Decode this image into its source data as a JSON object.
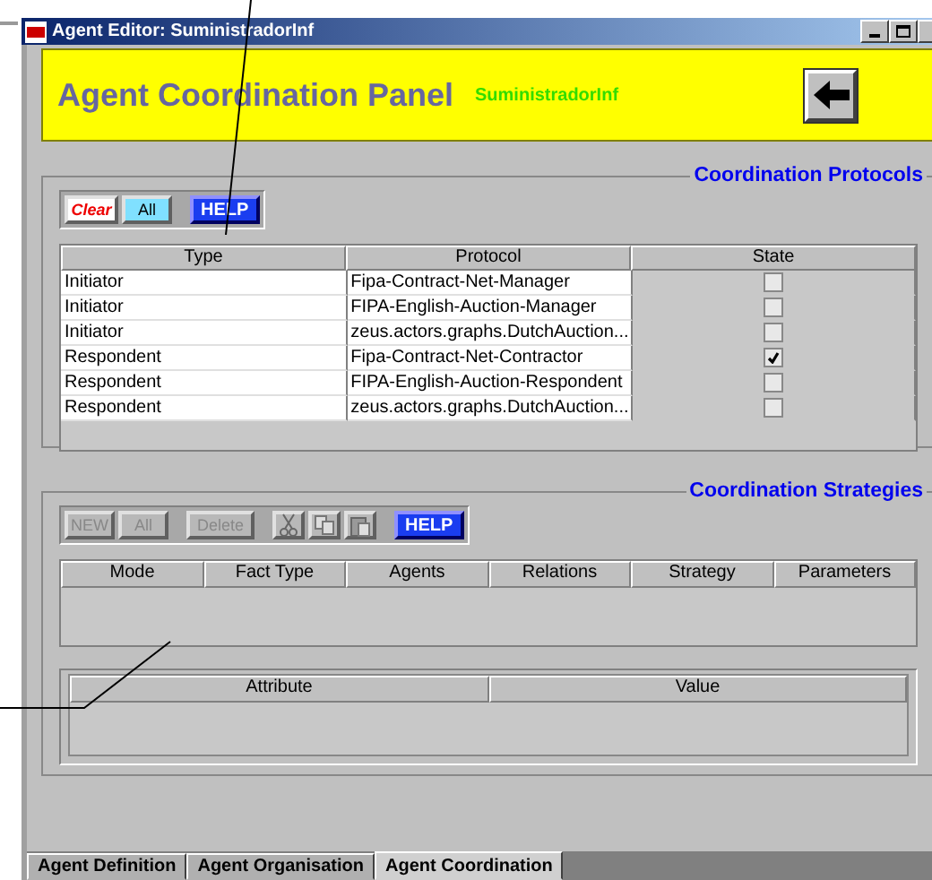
{
  "window": {
    "title": "Agent Editor: SuministradorInf"
  },
  "header": {
    "title": "Agent Coordination Panel",
    "agent": "SuministradorInf"
  },
  "protocols": {
    "title": "Coordination Protocols",
    "toolbar": [
      {
        "kind": "clear",
        "label": "Clear",
        "disabled": false
      },
      {
        "kind": "all",
        "label": "All",
        "disabled": false
      },
      {
        "kind": "help",
        "label": "HELP",
        "disabled": false
      }
    ],
    "columns": [
      "Type",
      "Protocol",
      "State"
    ],
    "rows": [
      {
        "type": "Initiator",
        "protocol": "Fipa-Contract-Net-Manager",
        "checked": false
      },
      {
        "type": "Initiator",
        "protocol": "FIPA-English-Auction-Manager",
        "checked": false
      },
      {
        "type": "Initiator",
        "protocol": "zeus.actors.graphs.DutchAuction...",
        "checked": false
      },
      {
        "type": "Respondent",
        "protocol": "Fipa-Contract-Net-Contractor",
        "checked": true
      },
      {
        "type": "Respondent",
        "protocol": "FIPA-English-Auction-Respondent",
        "checked": false
      },
      {
        "type": "Respondent",
        "protocol": "zeus.actors.graphs.DutchAuction...",
        "checked": false
      }
    ]
  },
  "strategies": {
    "title": "Coordination Strategies",
    "toolbar": [
      {
        "kind": "new",
        "label": "NEW",
        "disabled": true
      },
      {
        "kind": "all",
        "label": "All",
        "disabled": true
      },
      {
        "kind": "delete",
        "label": "Delete",
        "disabled": true
      },
      {
        "kind": "cut",
        "disabled": true
      },
      {
        "kind": "copy",
        "disabled": true
      },
      {
        "kind": "paste",
        "disabled": true
      },
      {
        "kind": "help",
        "label": "HELP",
        "disabled": false
      }
    ],
    "columns": [
      "Mode",
      "Fact Type",
      "Agents",
      "Relations",
      "Strategy",
      "Parameters"
    ],
    "attribute_columns": [
      "Attribute",
      "Value"
    ]
  },
  "tabs": [
    {
      "label": "Agent Definition",
      "selected": false
    },
    {
      "label": "Agent Organisation",
      "selected": false
    },
    {
      "label": "Agent Coordination",
      "selected": true
    }
  ]
}
